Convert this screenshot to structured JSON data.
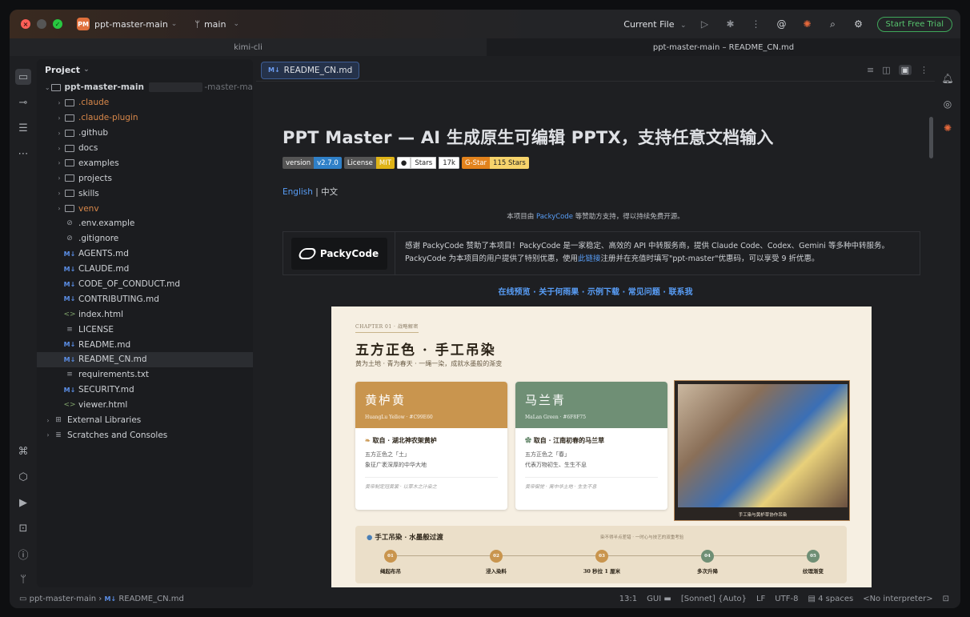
{
  "titlebar": {
    "project_badge": "PM",
    "project_name": "ppt-master-main",
    "branch": "main",
    "run_config": "Current File",
    "trial_button": "Start Free Trial"
  },
  "split_tabs": {
    "left": "kimi-cli",
    "right": "ppt-master-main – README_CN.md"
  },
  "project_panel": {
    "title": "Project",
    "root": "ppt-master-main",
    "root_suffix": "-master-ma",
    "items": [
      {
        "label": ".claude",
        "type": "folder",
        "color": "orange"
      },
      {
        "label": ".claude-plugin",
        "type": "folder",
        "color": "orange"
      },
      {
        "label": ".github",
        "type": "folder"
      },
      {
        "label": "docs",
        "type": "folder"
      },
      {
        "label": "examples",
        "type": "folder"
      },
      {
        "label": "projects",
        "type": "folder"
      },
      {
        "label": "skills",
        "type": "folder"
      },
      {
        "label": "venv",
        "type": "folder",
        "color": "orange"
      },
      {
        "label": ".env.example",
        "type": "file"
      },
      {
        "label": ".gitignore",
        "type": "file"
      },
      {
        "label": "AGENTS.md",
        "type": "md"
      },
      {
        "label": "CLAUDE.md",
        "type": "md"
      },
      {
        "label": "CODE_OF_CONDUCT.md",
        "type": "md"
      },
      {
        "label": "CONTRIBUTING.md",
        "type": "md"
      },
      {
        "label": "index.html",
        "type": "html"
      },
      {
        "label": "LICENSE",
        "type": "text"
      },
      {
        "label": "README.md",
        "type": "md"
      },
      {
        "label": "README_CN.md",
        "type": "md",
        "selected": true
      },
      {
        "label": "requirements.txt",
        "type": "text"
      },
      {
        "label": "SECURITY.md",
        "type": "md"
      },
      {
        "label": "viewer.html",
        "type": "html"
      }
    ],
    "external_libraries": "External Libraries",
    "scratches": "Scratches and Consoles"
  },
  "editor": {
    "tab_label": "README_CN.md",
    "md_prefix": "M↓",
    "heading": "PPT Master — AI 生成原生可编辑 PPTX，支持任意文档输入",
    "badges": {
      "version_l": "version",
      "version_r": "v2.7.0",
      "license_l": "License",
      "license_r": "MIT",
      "stars_l": "Stars",
      "stars_r": "17k",
      "gstar_l": "G-Star",
      "gstar_r": "115 Stars"
    },
    "lang_en": "English",
    "lang_sep": "|",
    "lang_cn": "中文",
    "sponsor_line_a": "本项目由",
    "sponsor_link": "PackyCode",
    "sponsor_line_b": "等赞助方支持，得以持续免费开源。",
    "sponsor_logo": "PackyCode",
    "sponsor_text_1": "感谢 PackyCode 赞助了本项目！PackyCode 是一家稳定、高效的 API 中转服务商，提供 Claude Code、Codex、Gemini 等多种中转服务。",
    "sponsor_text_2a": "PackyCode 为本项目的用户提供了特别优惠，使用",
    "sponsor_text_2link": "此链接",
    "sponsor_text_2b": "注册并在充值时填写\"ppt-master\"优惠码，可以享受 9 折优惠。",
    "nav_links": "在线预览 · 关于何雨果 · 示例下载 · 常见问题 · 联系我"
  },
  "slide": {
    "chapter": "CHAPTER 01 · 战略解密",
    "title": "五方正色 · 手工吊染",
    "subtitle": "黄为土地 · 青为春天 · 一绳一染，成就水墨般的渐变",
    "cards": [
      {
        "name": "黄栌黄",
        "code": "HuangLu Yellow · #C99E60",
        "title": "取自 · 湖北神农架黄栌",
        "l1": "五方正色之「土」",
        "l2": "象征广袤深厚的中华大地",
        "foot": "黄帝制定冠黄裳 · 以草木之汁染之",
        "color": "#c9954e"
      },
      {
        "name": "马兰青",
        "code": "MaLan Green · #6F8F75",
        "title": "取自 · 江南初春的马兰草",
        "l1": "五方正色之「春」",
        "l2": "代表万物初生、生生不息",
        "foot": "黄帝御觉 · 寓中华土地 · 生生不息",
        "color": "#6f8f75"
      }
    ],
    "photo_caption": "手工染与黄栌草协作吊染",
    "process_title": "手工吊染 · 水墨般过渡",
    "process_note": "染不得半点差错 · 一时心与技艺的双重考验",
    "steps": [
      {
        "num": "01",
        "label": "绳起布吊",
        "color": "#c9954e"
      },
      {
        "num": "02",
        "label": "浸入染料",
        "color": "#c9954e"
      },
      {
        "num": "03",
        "label": "30 秒拉 1 厘米",
        "color": "#c9954e"
      },
      {
        "num": "04",
        "label": "多次升降",
        "color": "#6f8f75"
      },
      {
        "num": "05",
        "label": "纹理渐变",
        "color": "#6f8f75"
      }
    ]
  },
  "statusbar": {
    "crumb_project": "ppt-master-main",
    "crumb_file": "README_CN.md",
    "position": "13:1",
    "gui": "GUI",
    "model": "[Sonnet] {Auto}",
    "line_sep": "LF",
    "encoding": "UTF-8",
    "indent": "4 spaces",
    "interpreter": "<No interpreter>"
  }
}
